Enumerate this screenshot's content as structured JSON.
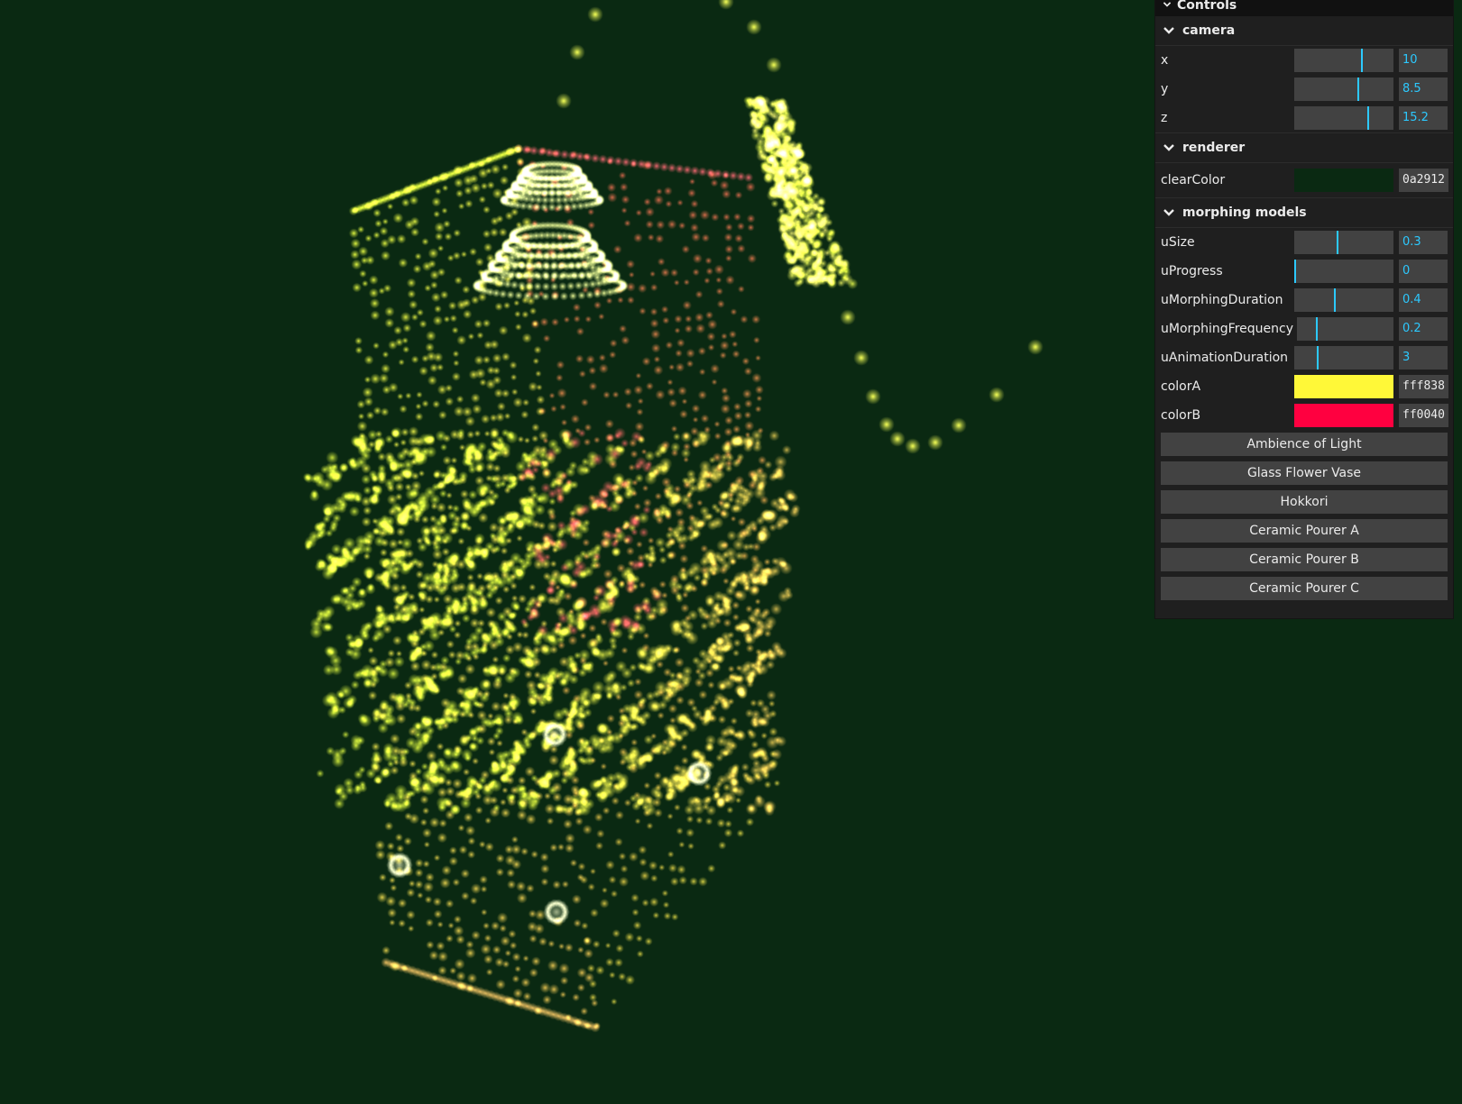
{
  "scene": {
    "background": "#0a2912",
    "color_a": "#fff838",
    "color_b": "#ff0040"
  },
  "gui": {
    "title": "Controls",
    "folders": {
      "camera": {
        "label": "camera",
        "x": {
          "label": "x",
          "value": "10",
          "fraction": 0.67
        },
        "y": {
          "label": "y",
          "value": "8.5",
          "fraction": 0.64
        },
        "z": {
          "label": "z",
          "value": "15.2",
          "fraction": 0.74
        }
      },
      "renderer": {
        "label": "renderer",
        "clearColor": {
          "label": "clearColor",
          "value": "0a2912",
          "color": "#0a2912"
        }
      },
      "morphing": {
        "label": "morphing models",
        "uSize": {
          "label": "uSize",
          "value": "0.3",
          "fraction": 0.43
        },
        "uProgress": {
          "label": "uProgress",
          "value": "0",
          "fraction": 0.0
        },
        "uMorphingDuration": {
          "label": "uMorphingDuration",
          "value": "0.4",
          "fraction": 0.4
        },
        "uMorphingFrequency": {
          "label": "uMorphingFrequency",
          "value": "0.2",
          "fraction": 0.2
        },
        "uAnimationDuration": {
          "label": "uAnimationDuration",
          "value": "3",
          "fraction": 0.23
        },
        "colorA": {
          "label": "colorA",
          "value": "fff838",
          "color": "#fff838"
        },
        "colorB": {
          "label": "colorB",
          "value": "ff0040",
          "color": "#ff0040"
        },
        "buttons": [
          "Ambience of Light",
          "Glass Flower Vase",
          "Hokkori",
          "Ceramic Pourer A",
          "Ceramic Pourer B",
          "Ceramic Pourer C"
        ]
      }
    }
  }
}
